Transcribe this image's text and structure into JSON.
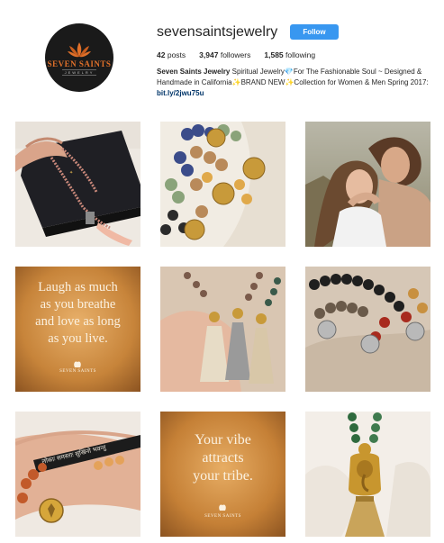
{
  "profile": {
    "username": "sevensaintsjewelry",
    "follow_label": "Follow",
    "avatar_logo_main": "SEVEN SAINTS",
    "avatar_logo_sub": "JEWELRY",
    "stats": {
      "posts_count": "42",
      "posts_label": "posts",
      "followers_count": "3,947",
      "followers_label": "followers",
      "following_count": "1,585",
      "following_label": "following"
    },
    "bio": {
      "name": "Seven Saints Jewelry",
      "text": " Spiritual Jewelry💎For The Fashionable Soul ~ Designed & Handmade in California✨BRAND NEW✨Collection for Women & Men Spring 2017: ",
      "link": "bit.ly/2jwu75u"
    }
  },
  "posts": [
    {
      "kind": "photo",
      "subject": "mala-on-box"
    },
    {
      "kind": "photo",
      "subject": "beaded-bracelets"
    },
    {
      "kind": "photo",
      "subject": "couple"
    },
    {
      "kind": "quote",
      "quote_lines": [
        "Laugh as much",
        "as you breathe",
        "and love as long",
        "as you live."
      ],
      "brand": "SEVEN SAINTS"
    },
    {
      "kind": "photo",
      "subject": "tassel-necklaces"
    },
    {
      "kind": "photo",
      "subject": "bracelets-on-sand"
    },
    {
      "kind": "photo",
      "subject": "mantra-bracelet",
      "engraving": "लोकाः समस्ताः सुखिनो भवन्तु"
    },
    {
      "kind": "quote",
      "quote_lines": [
        "Your vibe",
        "attracts",
        "your tribe."
      ],
      "brand": "SEVEN SAINTS"
    },
    {
      "kind": "photo",
      "subject": "ganesha-necklace"
    }
  ]
}
